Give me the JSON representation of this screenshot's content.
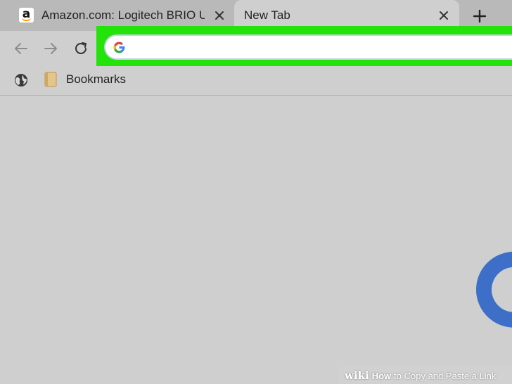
{
  "tabs": [
    {
      "title": "Amazon.com: Logitech BRIO Ultr",
      "favicon_letter": "a",
      "favicon_icon": "amazon-icon",
      "active": false
    },
    {
      "title": "New Tab",
      "active": true
    }
  ],
  "new_tab_icon": "plus-icon",
  "toolbar": {
    "back_icon": "arrow-left-icon",
    "forward_icon": "arrow-right-icon",
    "reload_icon": "reload-icon"
  },
  "omnibox": {
    "value": "",
    "placeholder": "",
    "search_engine_icon": "google-icon",
    "highlight_color": "#24e30a"
  },
  "bookmarks_bar": {
    "globe_icon": "globe-icon",
    "folder_icon": "folder-icon",
    "folder_label": "Bookmarks"
  },
  "watermark": {
    "brand": "wiki",
    "how": "How",
    "title": "to Copy and Paste a Link"
  },
  "colors": {
    "google_blue": "#4285f4",
    "page_bg": "#cfcfcf",
    "tabstrip_bg": "#b9b9b9"
  }
}
